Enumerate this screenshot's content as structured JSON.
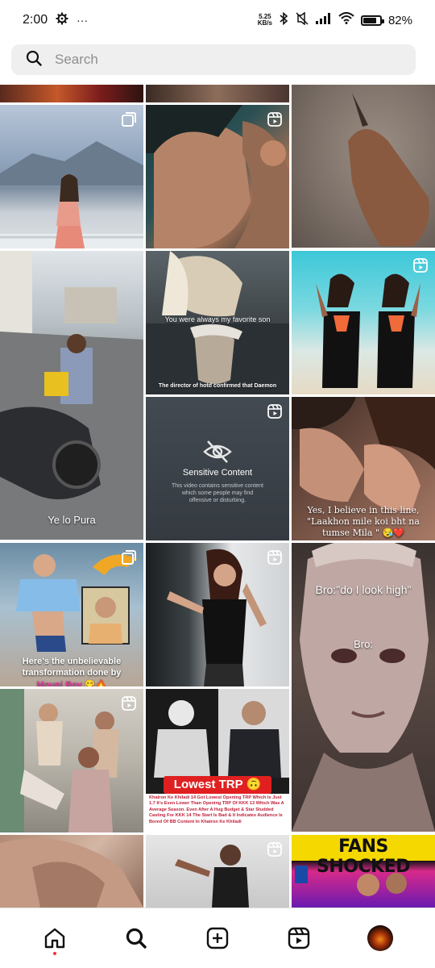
{
  "status_bar": {
    "time": "2:00",
    "overflow": "···",
    "net_speed_value": "5.25",
    "net_speed_unit": "KB/s",
    "battery_percent": "82%",
    "battery_level": 0.82
  },
  "search": {
    "placeholder": "Search",
    "value": ""
  },
  "tiles": [
    {
      "name": "tile-1",
      "badge": "none",
      "caption": ""
    },
    {
      "name": "tile-2",
      "badge": "none",
      "caption": ""
    },
    {
      "name": "tile-3",
      "badge": "none",
      "caption": ""
    },
    {
      "name": "tile-4",
      "badge": "carousel",
      "caption": ""
    },
    {
      "name": "tile-5",
      "badge": "reel",
      "caption": ""
    },
    {
      "name": "tile-6",
      "badge": "none",
      "caption": ""
    },
    {
      "name": "tile-7",
      "badge": "none",
      "caption": "Ye lo Pura"
    },
    {
      "name": "tile-8",
      "badge": "none",
      "caption": "You were always my favorite son",
      "subcaption": "The director of hotd confirmed that Daemon"
    },
    {
      "name": "tile-9",
      "badge": "reel",
      "caption": ""
    },
    {
      "name": "tile-10",
      "badge": "reel",
      "caption": "Sensitive Content",
      "subcaption": "This video contains sensitive content which some people may find offensive or disturbing."
    },
    {
      "name": "tile-11",
      "badge": "none",
      "caption": "Yes, I believe in this line, \"Laakhon mile koi bht na tumse Mila \" 😪❤️"
    },
    {
      "name": "tile-12",
      "badge": "carousel",
      "caption": "Here's the unbelievable transformation done by",
      "highlight": "Mouni Roy 😋🔥"
    },
    {
      "name": "tile-13",
      "badge": "reel",
      "caption": ""
    },
    {
      "name": "tile-14",
      "badge": "none",
      "caption": "Bro:\"do I look high\"",
      "subcaption": "Bro:"
    },
    {
      "name": "tile-15",
      "badge": "reel",
      "caption": ""
    },
    {
      "name": "tile-16",
      "badge": "none",
      "caption": "Lowest TRP 🙃",
      "subcaption": "Khatron Ke Khiladi 14 Got Lowest Opening TRP Which Is Just 1.7 It's Even Lower Than Opening TRP Of KKK 13 Which Was A Average Season. Even After A Hug Budget & Star Studded Casting For KKK 14 The Start Is Bad & It Indicates Audience Is Bored Of BB Content In Khatron Ke Khiladi"
    },
    {
      "name": "tile-17",
      "badge": "none",
      "caption": ""
    },
    {
      "name": "tile-18",
      "badge": "reel",
      "caption": ""
    },
    {
      "name": "tile-19",
      "badge": "none",
      "caption": "FANS SHOCKED"
    }
  ],
  "nav": [
    {
      "name": "home",
      "icon": "home-icon",
      "active": true
    },
    {
      "name": "search",
      "icon": "search-icon",
      "active": false
    },
    {
      "name": "create",
      "icon": "plus-square-icon",
      "active": false
    },
    {
      "name": "reels",
      "icon": "reels-icon",
      "active": false
    },
    {
      "name": "profile",
      "icon": "avatar",
      "active": false
    }
  ],
  "colors": {
    "notification_dot": "#ff3040",
    "search_bg": "#efefef",
    "divider": "#dbdbdb"
  }
}
